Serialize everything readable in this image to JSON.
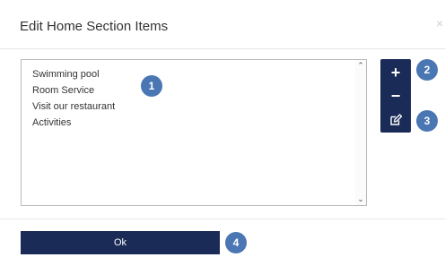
{
  "dialog": {
    "title": "Edit Home Section Items",
    "close_glyph": "×"
  },
  "list": {
    "items": [
      "Swimming pool",
      "Room Service",
      "Visit our restaurant",
      "Activities"
    ],
    "scroll_up_glyph": "⌃",
    "scroll_down_glyph": "⌄"
  },
  "toolbar": {
    "add_glyph": "+",
    "remove_glyph": "−",
    "edit_icon": "edit-icon"
  },
  "badges": [
    "1",
    "2",
    "3",
    "4"
  ],
  "footer": {
    "ok_label": "Ok"
  },
  "colors": {
    "accent": "#1b2b57",
    "badge": "#4a76b3"
  }
}
